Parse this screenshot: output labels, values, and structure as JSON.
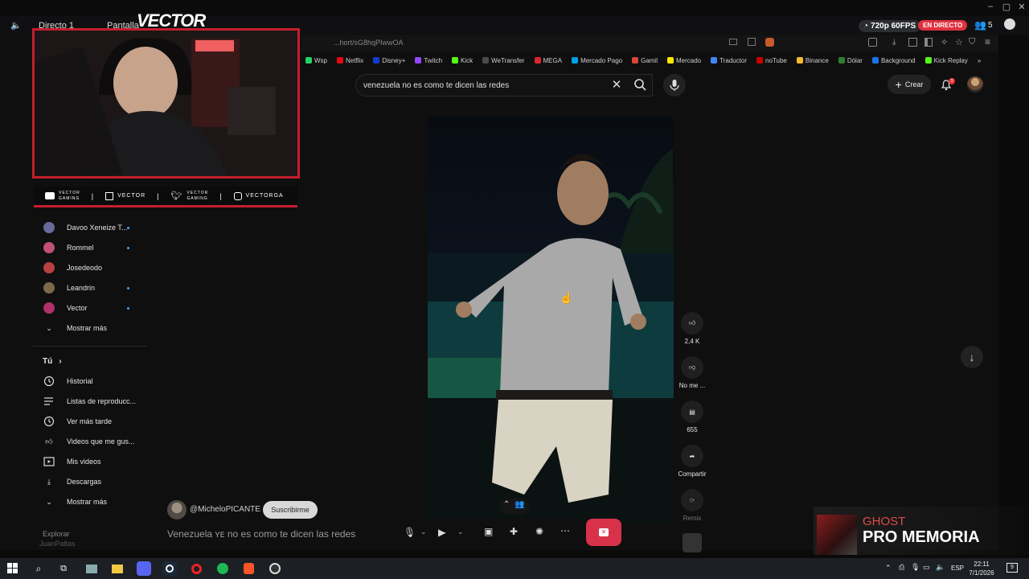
{
  "discord": {
    "channel": "Directo 1",
    "screen_label": "Pantalla",
    "quality": "720p 60FPS",
    "live": "EN DIRECTO",
    "viewers": "5"
  },
  "browser": {
    "url": "...hort/sG8hqPIwwOA",
    "bookmarks": [
      "Wsp",
      "Netflix",
      "Disney+",
      "Twitch",
      "Kick",
      "WeTransfer",
      "MEGA",
      "Mercado Pago",
      "Gamil",
      "Mercado",
      "Traductor",
      "noTube",
      "Binance",
      "Dólar",
      "Background",
      "Kick Replay"
    ]
  },
  "youtube": {
    "search_value": "venezuela no es como te dicen las redes",
    "create": "Crear",
    "notif_count": "3",
    "subscriptions": [
      {
        "name": "Davoo Xeneize T...",
        "color": "#6a6a9a"
      },
      {
        "name": "Rommel",
        "color": "#c0507a"
      },
      {
        "name": "Josedeodo",
        "color": "#b84040"
      },
      {
        "name": "Leandrin",
        "color": "#7a6a4a"
      },
      {
        "name": "Vector",
        "color": "#b0306a"
      }
    ],
    "show_more": "Mostrar más",
    "you_section": "Tú",
    "you_items": [
      "Historial",
      "Listas de reproducc...",
      "Ver más tarde",
      "Videos que me gus...",
      "Mis videos",
      "Descargas",
      "Mostrar más"
    ],
    "explore": "Explorar",
    "likes": "2,4 K",
    "dislike": "No me ...",
    "comments": "655",
    "share": "Compartir",
    "remix": "Remix",
    "channel": "@MicheloPICANTE",
    "subscribe": "Suscribirme",
    "title": "Venezuela ʏᴇ no es como te dicen las redes"
  },
  "stream": {
    "logo": "VECTOR",
    "socials": [
      {
        "icon": "youtube-icon",
        "label": "VECTOR\nGAMING"
      },
      {
        "icon": "twitch-icon",
        "label": "VECTOR"
      },
      {
        "icon": "twitter-icon",
        "label": "VECTOR\nGAMING"
      },
      {
        "icon": "instagram-icon",
        "label": "VECTORGA"
      }
    ],
    "chat_user": "JuanPaltas"
  },
  "now_playing": {
    "artist": "GHOST",
    "title": "PRO MEMORIA"
  },
  "taskbar": {
    "lang": "ESP",
    "time": "22:11",
    "date": "7/1/2026",
    "notif": "9"
  }
}
